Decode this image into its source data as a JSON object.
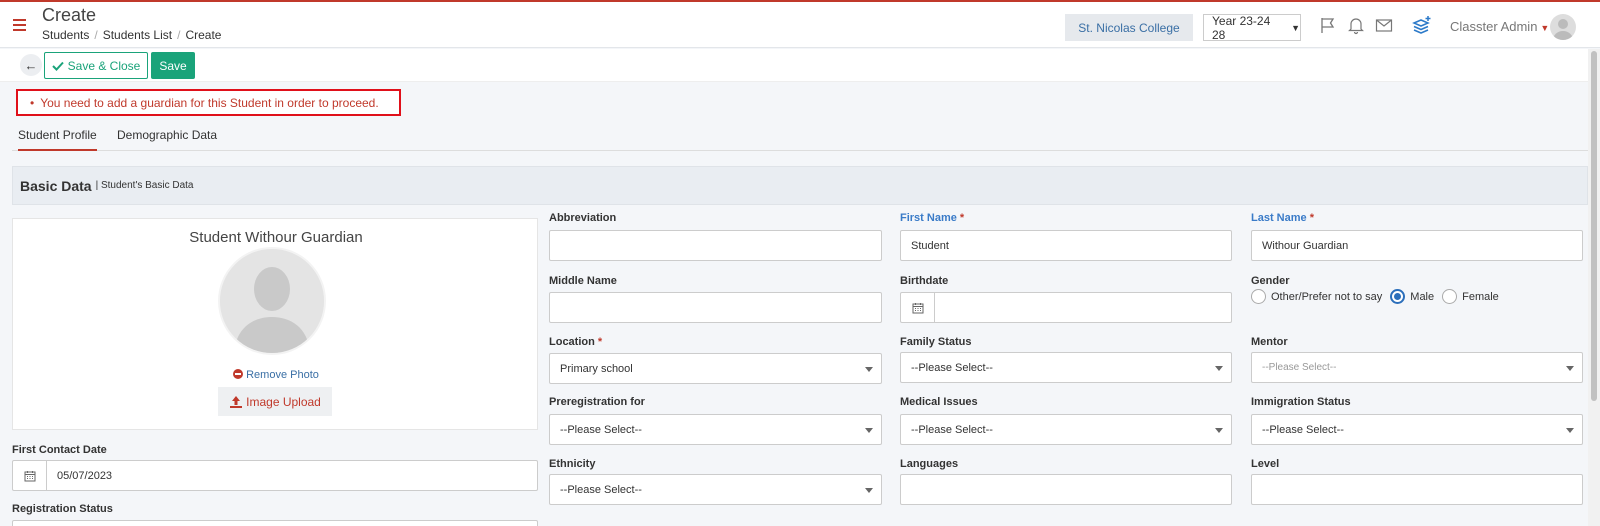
{
  "header": {
    "title": "Create",
    "breadcrumbs": [
      "Students",
      "Students List",
      "Create"
    ],
    "college": "St. Nicolas College",
    "year": "Year 23-24 28",
    "user": "Classter Admin"
  },
  "toolbar": {
    "save_close_label": "Save & Close",
    "save_label": "Save"
  },
  "alert": {
    "message": "You need to add a guardian for this Student in order to proceed."
  },
  "tabs": [
    {
      "label": "Student Profile",
      "active": true
    },
    {
      "label": "Demographic Data",
      "active": false
    }
  ],
  "section": {
    "title": "Basic Data",
    "subtitle": "| Student's Basic Data"
  },
  "photo": {
    "student_name": "Student Withour Guardian",
    "remove_label": "Remove Photo",
    "upload_label": "Image Upload"
  },
  "form": {
    "first_contact_date": {
      "label": "First Contact Date",
      "value": "05/07/2023"
    },
    "registration_status": {
      "label": "Registration Status"
    },
    "abbreviation": {
      "label": "Abbreviation",
      "value": ""
    },
    "first_name": {
      "label": "First Name",
      "required": "*",
      "value": "Student"
    },
    "last_name": {
      "label": "Last Name",
      "required": "*",
      "value": "Withour Guardian"
    },
    "middle_name": {
      "label": "Middle Name",
      "value": ""
    },
    "birthdate": {
      "label": "Birthdate",
      "value": ""
    },
    "gender": {
      "label": "Gender",
      "options": [
        "Other/Prefer not to say",
        "Male",
        "Female"
      ],
      "selected": "Male"
    },
    "location": {
      "label": "Location",
      "required": "*",
      "value": "Primary school"
    },
    "family_status": {
      "label": "Family Status",
      "value": "--Please Select--"
    },
    "mentor": {
      "label": "Mentor",
      "value": "--Please Select--"
    },
    "preregistration": {
      "label": "Preregistration for",
      "value": "--Please Select--"
    },
    "medical_issues": {
      "label": "Medical Issues",
      "value": "--Please Select--"
    },
    "immigration_status": {
      "label": "Immigration Status",
      "value": "--Please Select--"
    },
    "ethnicity": {
      "label": "Ethnicity",
      "value": "--Please Select--"
    },
    "languages": {
      "label": "Languages",
      "value": ""
    },
    "level": {
      "label": "Level",
      "value": ""
    }
  },
  "colors": {
    "accent_red": "#c0392b",
    "save_green": "#1aa37a",
    "link_blue": "#3a6fa5",
    "alert_border": "#e0101a"
  }
}
